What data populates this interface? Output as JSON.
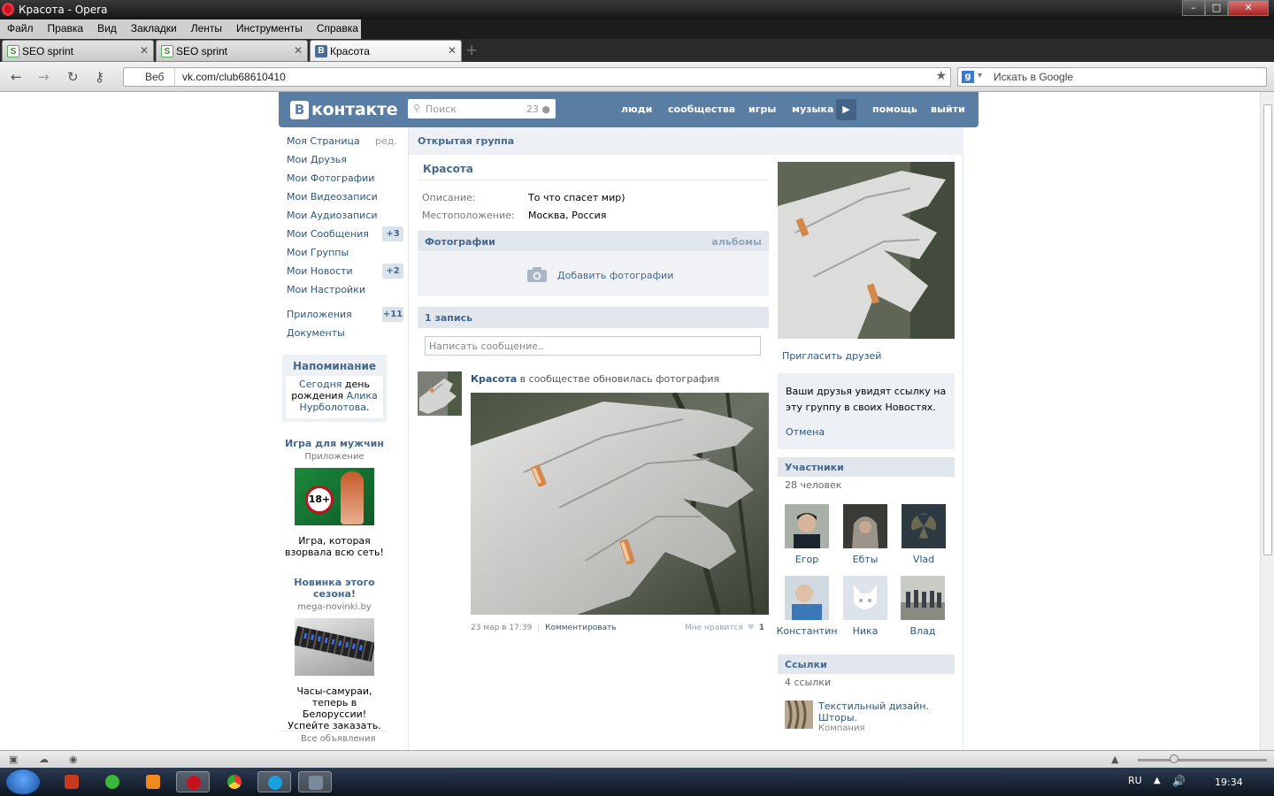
{
  "window": {
    "title": "Красота - Opera"
  },
  "menu": [
    "Файл",
    "Правка",
    "Вид",
    "Закладки",
    "Ленты",
    "Инструменты",
    "Справка"
  ],
  "tabs": [
    {
      "label": "SEO sprint",
      "favicon": "seo-sprint-icon"
    },
    {
      "label": "SEO sprint",
      "favicon": "seo-sprint-icon"
    },
    {
      "label": "Красота",
      "favicon": "vk-icon",
      "active": true
    }
  ],
  "address": {
    "badge": "Веб",
    "url": "vk.com/club68610410"
  },
  "search_engine": {
    "placeholder": "Искать в Google"
  },
  "vk": {
    "logo": "контакте",
    "logo_letter": "В",
    "search_placeholder": "Поиск",
    "search_count": "23",
    "nav": [
      "люди",
      "сообщества",
      "игры",
      "музыка",
      "помощь",
      "выйти"
    ],
    "left_menu": [
      {
        "label": "Моя Страница",
        "extra": "ред."
      },
      {
        "label": "Мои Друзья"
      },
      {
        "label": "Мои Фотографии"
      },
      {
        "label": "Мои Видеозаписи"
      },
      {
        "label": "Мои Аудиозаписи"
      },
      {
        "label": "Мои Сообщения",
        "badge": "+3"
      },
      {
        "label": "Мои Группы"
      },
      {
        "label": "Мои Новости",
        "badge": "+2"
      },
      {
        "label": "Мои Настройки"
      },
      {
        "label": "Приложения",
        "badge": "+11"
      },
      {
        "label": "Документы"
      }
    ],
    "reminder": {
      "title": "Напоминание",
      "w1": "Сегодня",
      "w2": " день рождения ",
      "w3": "Алика Нурболотова",
      "w4": "."
    },
    "ads": [
      {
        "title": "Игра для мужчин",
        "subtitle": "Приложение",
        "badge": "18+",
        "text": "Игра, которая взорвала всю сеть!"
      },
      {
        "title": "Новинка этого сезона!",
        "subtitle": "mega-novinki.by",
        "text": "Часы-самураи, теперь в Белоруссии! Успейте заказать."
      }
    ],
    "all_ads": "Все объявления",
    "group": {
      "type": "Открытая группа",
      "name": "Красота",
      "description_label": "Описание:",
      "description": "То что спасет мир)",
      "location_label": "Местоположение:",
      "location": "Москва, Россия",
      "photos_header": "Фотографии",
      "albums_link": "альбомы",
      "add_photos": "Добавить фотографии",
      "posts_header": "1 запись",
      "message_placeholder": "Написать сообщение..",
      "post": {
        "author": "Красота",
        "action": " в сообществе обновилась фотография",
        "date": "23 мар в 17:39",
        "separator": "|",
        "comment": "Комментировать",
        "like_label": "Мне нравится",
        "like_count": "1"
      }
    },
    "right": {
      "invite_link": "Пригласить друзей",
      "invite_text": "Ваши друзья увидят ссылку на эту группу в своих Новостях.",
      "cancel": "Отмена",
      "members_header": "Участники",
      "members_count": "28 человек",
      "members": [
        "Егор",
        "Ебты",
        "Vlad",
        "Константин",
        "Ника",
        "Влад"
      ],
      "links_header": "Ссылки",
      "links_count": "4 ссылки",
      "link": {
        "title": "Текстильный дизайн. Шторы.",
        "subtitle": "Компания"
      }
    }
  },
  "tray": {
    "lang": "RU",
    "time": "19:34"
  }
}
